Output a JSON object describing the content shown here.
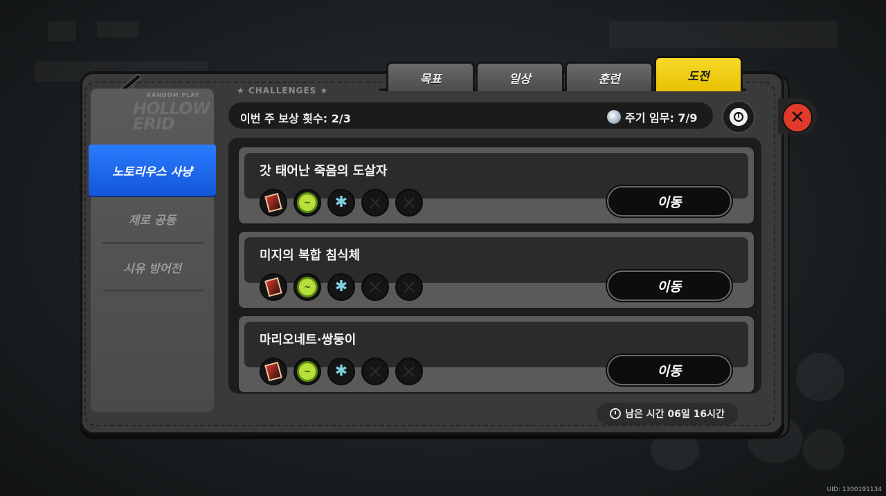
{
  "header": {
    "section_label": "★ CHALLENGES ★",
    "weekly_rewards": "이번 주 보상 횟수: 2/3",
    "cycle_tasks": "주기 임무: 7/9"
  },
  "tabs": [
    {
      "label": "목표",
      "active": false
    },
    {
      "label": "일상",
      "active": false
    },
    {
      "label": "훈련",
      "active": false
    },
    {
      "label": "도전",
      "active": true
    }
  ],
  "sidebar": {
    "logo_small": "RANDOM PLAY",
    "logo": "HOLLOW ERID",
    "items": [
      {
        "label": "노토리우스 사냥",
        "active": true
      },
      {
        "label": "제로 공동",
        "active": false
      },
      {
        "label": "시유 방어전",
        "active": false
      }
    ]
  },
  "challenges": [
    {
      "title": "갓 태어난 죽음의 도살자",
      "button": "이동"
    },
    {
      "title": "미지의 복합 침식체",
      "button": "이동"
    },
    {
      "title": "마리오네트·쌍둥이",
      "button": "이동"
    }
  ],
  "time_remaining": "남은 시간 06일 16시간",
  "uid": "UID: 1300191134",
  "colors": {
    "accent_yellow": "#f2cf10",
    "active_blue": "#1e6cf0",
    "close_red": "#e03a2a"
  }
}
